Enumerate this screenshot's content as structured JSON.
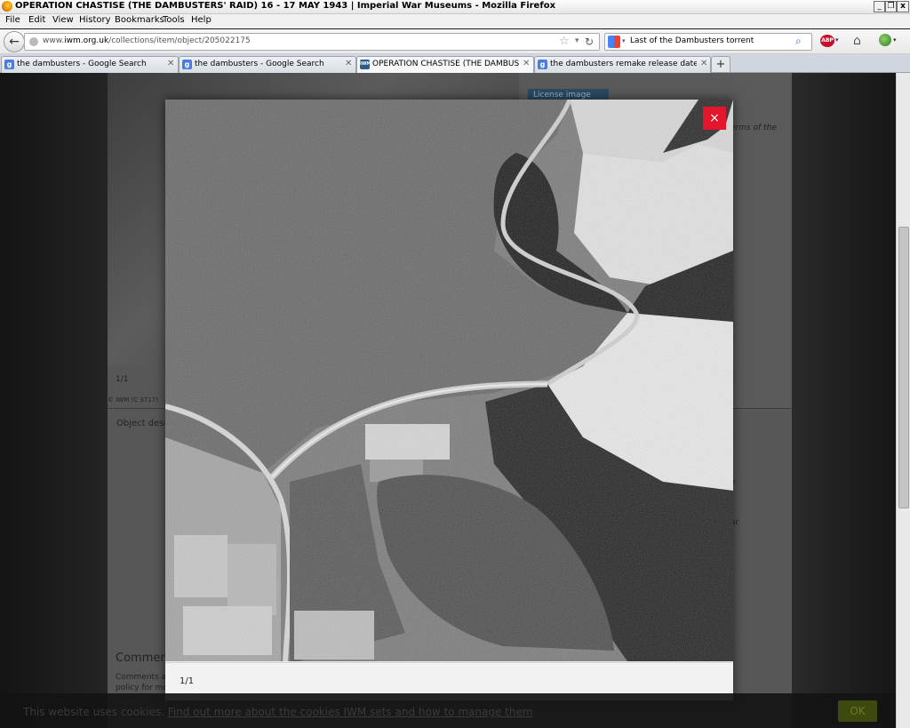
{
  "window": {
    "title": "OPERATION CHASTISE (THE DAMBUSTERS' RAID) 16 - 17 MAY 1943 | Imperial War Museums - Mozilla Firefox",
    "minimize": "_",
    "restore": "❐",
    "close": "x"
  },
  "menu": [
    "File",
    "Edit",
    "View",
    "History",
    "Bookmarks",
    "Tools",
    "Help"
  ],
  "nav": {
    "url_prefix": "www.",
    "url_domain": "iwm.org.uk",
    "url_path": "/collections/item/object/205022175",
    "search_value": "Last of the Dambusters torrent"
  },
  "tabs": [
    {
      "label": "the dambusters - Google Search",
      "icon": "g"
    },
    {
      "label": "the dambusters - Google Search",
      "icon": "g"
    },
    {
      "label": "OPERATION CHASTISE (THE DAMBUSTE...",
      "icon": "iwm",
      "active": true
    },
    {
      "label": "the dambusters remake release date - G...",
      "icon": "g"
    }
  ],
  "page": {
    "license_button": "License image",
    "terms_fragment": "erms of the",
    "counter_bg": "1/1",
    "iwm_ref": "© IWM (C 3717)",
    "object_description": "Object desc",
    "comments_heading": "Comment",
    "comments_line1": "Comments a",
    "comments_line2": "policy for mo",
    "side_y": "y",
    "side_ar": "ar"
  },
  "modal": {
    "close_glyph": "×",
    "counter": "1/1"
  },
  "cookie": {
    "text": "This website uses cookies.",
    "link": "Find out more about the cookies IWM sets and how to manage them",
    "ok": "OK"
  }
}
